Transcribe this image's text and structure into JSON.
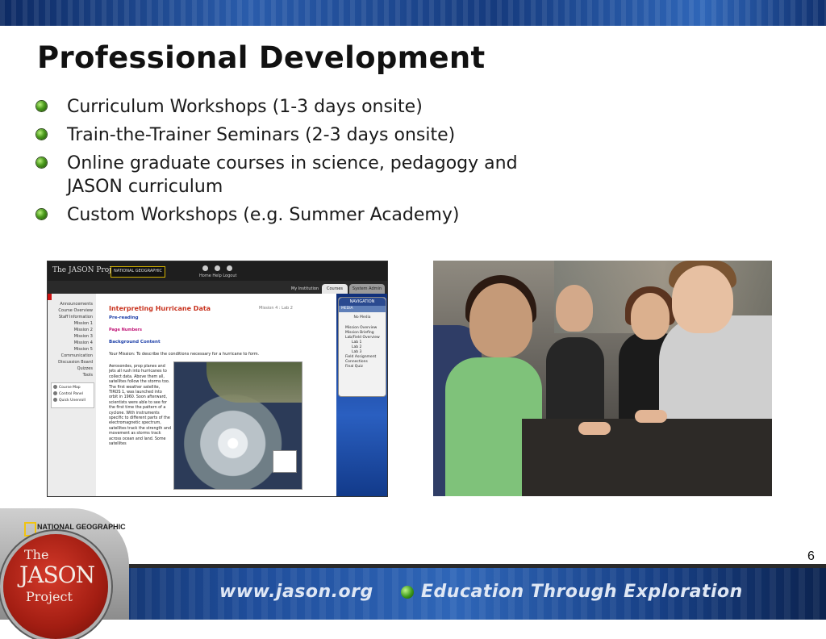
{
  "slide": {
    "title": "Professional Development",
    "bullets": [
      "Curriculum Workshops (1-3 days onsite)",
      "Train-the-Trainer Seminars (2-3 days onsite)",
      "Online graduate courses in science, pedagogy and JASON curriculum",
      "Custom Workshops (e.g. Summer Academy)"
    ],
    "page_number": "6"
  },
  "screenshot": {
    "logo_text": "The JASON Project",
    "ng_badge": "NATIONAL GEOGRAPHIC",
    "header_links": "Home  Help  Logout",
    "tabs": [
      "My Institution",
      "Courses",
      "System Admin"
    ],
    "sidebar": [
      "Announcements",
      "Course Overview",
      "Staff Information",
      "Mission 1",
      "Mission 2",
      "Mission 3",
      "Mission 4",
      "Mission 5",
      "Communication",
      "Discussion Board",
      "Quizzes",
      "Tools"
    ],
    "sidebar_tools": [
      "Course Map",
      "Control Panel",
      "Quick Unenroll"
    ],
    "content": {
      "title": "Interpreting Hurricane Data",
      "mission": "Mission 4 : Lab 2",
      "pre_reading": "Pre-reading",
      "page_numbers": "Page Numbers",
      "background": "Background Content",
      "your_mission": "Your Mission: To describe the conditions necessary for a hurricane to form.",
      "body": "Aerosondes, prop planes and jets all rush into hurricanes to collect data. Above them all, satellites follow the storms too. The first weather satellite, TIROS 1, was launched into orbit in 1960. Soon afterward, scientists were able to see for the first time the pattern of a cyclone. With instruments specific to different parts of the electromagnetic spectrum, satellites track the strength and movement as storms track across ocean and land. Some satellites"
    },
    "navigation": {
      "header": "NAVIGATION",
      "media_label": "MEDIA",
      "no_media": "No Media",
      "items": [
        "Mission Overview",
        "Mission Briefing",
        "Lab/Field Overview",
        "Lab 1",
        "Lab 2",
        "Lab 3",
        "Field Assignment",
        "Connections",
        "Final Quiz"
      ]
    }
  },
  "footer": {
    "url": "www.jason.org",
    "slogan": "Education Through Exploration",
    "ng_label": "NATIONAL GEOGRAPHIC",
    "logo_the": "The",
    "logo_jason": "JASON",
    "logo_project": "Project"
  },
  "colors": {
    "title": "#111111",
    "bullet_green": "#4a9a1c",
    "banner_blue": "#1f4d9a",
    "logo_red": "#a21d12"
  }
}
